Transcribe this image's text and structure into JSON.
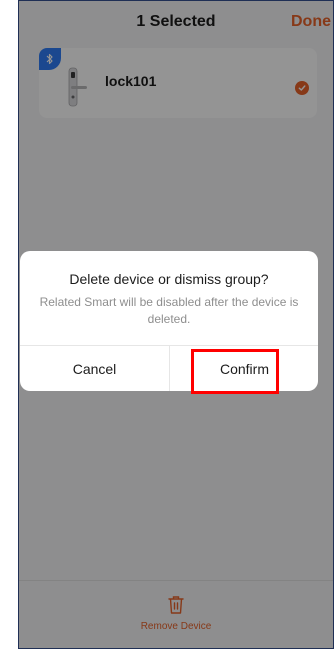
{
  "header": {
    "title": "1 Selected",
    "done_label": "Done"
  },
  "device": {
    "name": "lock101",
    "selected": true
  },
  "dialog": {
    "title": "Delete device or dismiss group?",
    "message": "Related Smart will be disabled after the device is deleted.",
    "cancel_label": "Cancel",
    "confirm_label": "Confirm"
  },
  "bottom_bar": {
    "remove_label": "Remove Device"
  },
  "colors": {
    "accent": "#e8622a",
    "bluetooth": "#2f7df6",
    "highlight": "#ff0000"
  },
  "icons": {
    "bluetooth": "bluetooth-icon",
    "check": "check-icon",
    "trash": "trash-icon"
  }
}
